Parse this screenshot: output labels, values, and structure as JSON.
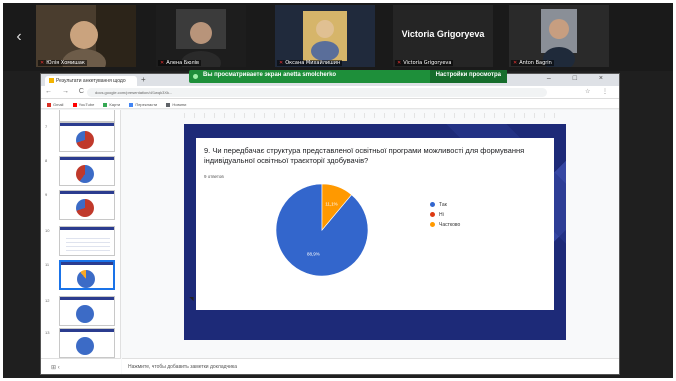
{
  "meeting": {
    "nav_prev": "‹",
    "participants": [
      {
        "name": "Юлія Хомишак",
        "mic": "muted"
      },
      {
        "name": "Алена Бюлів",
        "mic": "muted"
      },
      {
        "name": "Оксана Михайлишин",
        "mic": "muted"
      },
      {
        "name": "Victoria Grigoryeva",
        "mic": "muted",
        "display": "Victoria Grigoryeva"
      },
      {
        "name": "Anton Bagrin",
        "mic": "muted"
      }
    ],
    "share_banner": {
      "text": "Вы просматриваете экран anetta smolcherko",
      "options": "Настройки просмотра"
    }
  },
  "browser": {
    "tab_title": "Результати анкетування щодо",
    "new_tab": "+",
    "window_controls": "– □ ×",
    "nav": "← → C",
    "url": "docs.google.com/presentation/d/1wqk3Xk...",
    "extensions": "☆ ⋮",
    "bookmarks": [
      "Gmail",
      "YouTube",
      "Карти",
      "Перекласти",
      "Новини"
    ]
  },
  "slides": {
    "thumbnails": [
      {
        "num": "",
        "style": "band"
      },
      {
        "num": "7",
        "style": "red"
      },
      {
        "num": "8",
        "style": "mix"
      },
      {
        "num": "9",
        "style": "red"
      },
      {
        "num": "10",
        "style": "lines"
      },
      {
        "num": "11",
        "style": "blue",
        "selected": true
      },
      {
        "num": "12",
        "style": "plain"
      },
      {
        "num": "13",
        "style": "plain"
      }
    ],
    "question": "9. Чи передбачає структура представленої освітньої програми можливості для формування індивідуальної освітньої траєкторії здобувачів?",
    "responses": "9 ответов",
    "notes_placeholder": "Нажмите, чтобы добавить заметки докладчика",
    "bottom_left": "⊞ ‹"
  },
  "chart_data": {
    "type": "pie",
    "labels": [
      "Так",
      "Ні",
      "Частково"
    ],
    "values": [
      88.9,
      0,
      11.1
    ],
    "data_labels": [
      "88,9%",
      "",
      "11,1%"
    ],
    "colors": [
      "#3366cc",
      "#dc3912",
      "#ff9900"
    ],
    "legend_position": "right"
  }
}
